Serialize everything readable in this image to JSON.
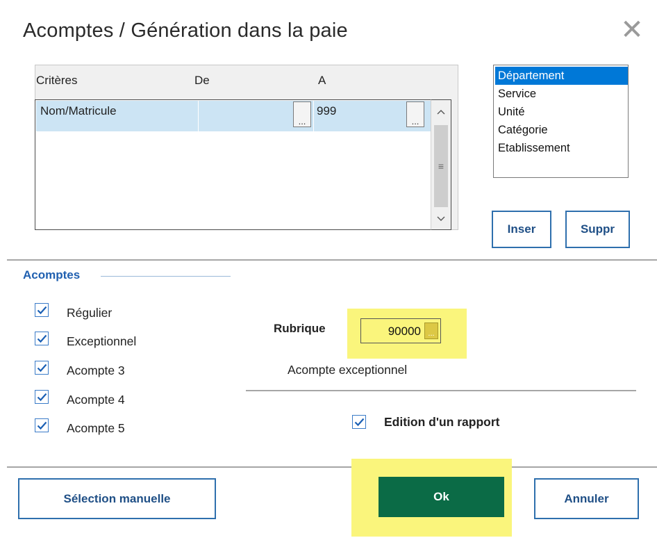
{
  "title": "Acomptes / Génération dans la paie",
  "criteria": {
    "headers": [
      "Critères",
      "De",
      "A"
    ],
    "rows": [
      {
        "critere": "Nom/Matricule",
        "de": "",
        "a": "999"
      }
    ],
    "ellipsis": "..."
  },
  "groups_list": {
    "items": [
      "Département",
      "Service",
      "Unité",
      "Catégorie",
      "Etablissement"
    ],
    "selected": "Département"
  },
  "buttons": {
    "inser": "Inser",
    "suppr": "Suppr",
    "selection_manuelle": "Sélection manuelle",
    "ok": "Ok",
    "annuler": "Annuler"
  },
  "acomptes": {
    "section_label": "Acomptes",
    "checkboxes": [
      {
        "label": "Régulier",
        "checked": true
      },
      {
        "label": "Exceptionnel",
        "checked": true
      },
      {
        "label": "Acompte 3",
        "checked": true
      },
      {
        "label": "Acompte 4",
        "checked": true
      },
      {
        "label": "Acompte 5",
        "checked": true
      }
    ]
  },
  "rubrique": {
    "label": "Rubrique",
    "value": "90000",
    "description": "Acompte exceptionnel"
  },
  "edition": {
    "label": "Edition d'un rapport",
    "checked": true
  },
  "colors": {
    "accent": "#2e6fad",
    "section_blue": "#2060b0",
    "ok_green": "#0b6b46",
    "highlight_yellow": "#faf57c",
    "row_selection": "#cce4f4",
    "list_selection": "#0078d7"
  },
  "icons": {
    "close": "close-icon",
    "scroll_up": "chevron-up-icon",
    "scroll_down": "chevron-down-icon",
    "check": "checkmark-icon"
  }
}
